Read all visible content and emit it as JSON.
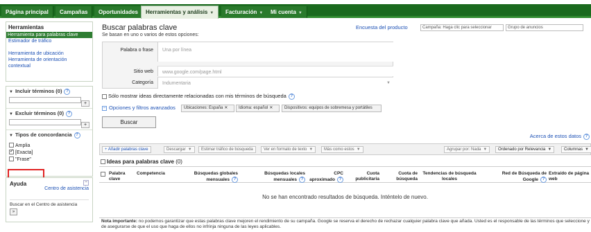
{
  "nav": {
    "tabs": [
      {
        "label": "Página principal"
      },
      {
        "label": "Campañas"
      },
      {
        "label": "Oportunidades"
      },
      {
        "label": "Herramientas y análisis"
      },
      {
        "label": "Facturación"
      },
      {
        "label": "Mi cuenta"
      }
    ]
  },
  "sidebar": {
    "tools_heading": "Herramientas",
    "tools": [
      "Herramienta para palabras clave",
      "Estimador de tráfico",
      "Herramienta de ubicación",
      "Herramienta de orientación contextual"
    ],
    "include_heading": "Incluir términos (0)",
    "exclude_heading": "Excluir términos (0)",
    "match_heading": "Tipos de concordancia",
    "match_types": [
      {
        "label": "Amplia",
        "checked": false
      },
      {
        "label": "[Exacta]",
        "checked": true
      },
      {
        "label": "\"Frase\"",
        "checked": false
      }
    ],
    "plus": "+",
    "help_heading": "Ayuda",
    "help_link": "Centro de asistencia",
    "help_search": "Buscar en el Centro de asistencia",
    "help_search_btn": "»"
  },
  "main": {
    "title": "Buscar palabras clave",
    "subtitle": "Se basan en uno o varios de estos opciones:",
    "survey_link": "Encuesta del producto",
    "campaign_select": "Campaña: Haga clic para seleccionar",
    "adgroup_select": "Grupo de anuncios",
    "form": {
      "word_label": "Palabra o frase",
      "word_placeholder": "Una por línea",
      "site_label": "Sitio web",
      "site_placeholder": "www.google.com/page.html",
      "category_label": "Categoría",
      "category_placeholder": "Indumentaria"
    },
    "only_show": "Sólo mostrar ideas directamente relacionadas con mis términos de búsqueda",
    "options_link": "Opciones y filtros avanzados",
    "chips": [
      "Ubicaciones: España",
      "Idioma: español",
      "Dispositivos: equipos de sobremesa y portátiles"
    ],
    "chip_close": "✕",
    "search_button": "Buscar",
    "about_link": "Acerca de estos datos",
    "toolbar": {
      "add": "Añadir palabras clave",
      "download": "Descargar",
      "estimate": "Estimar tráfico de búsqueda",
      "view_text": "Ver en formato de texto",
      "more_like": "Más como estos",
      "group_by": "Agrupar por: Nada",
      "sort_by": "Ordenado por Relevancia",
      "columns": "Columnas"
    },
    "ideas_heading": "Ideas para palabras clave",
    "ideas_count": "(0)",
    "columns": [
      "Palabra clave",
      "Competencia",
      "Búsquedas globales mensuales",
      "Búsquedas locales mensuales",
      "CPC aproximado",
      "Cuota publicitaria",
      "Cuota de búsqueda",
      "Tendencias de búsqueda locales",
      "Red de Búsqueda de Google",
      "Extraído de página web"
    ],
    "no_results": "No se han encontrado resultados de búsqueda. Inténtelo de nuevo.",
    "note_bold": "Nota importante:",
    "note_text": " no podemos garantizar que estas palabras clave mejoren el rendimiento de su campaña. Google se reserva el derecho de rechazar cualquier palabra clave que añada. Usted es el responsable de las términos que seleccione y de asegurarse de que el uso que haga de ellos no infrinja ninguna de las leyes aplicables."
  },
  "colors": {
    "nav_green": "#1a6a1e",
    "link_blue": "#1a4fb4",
    "highlight_red": "#e02020"
  }
}
